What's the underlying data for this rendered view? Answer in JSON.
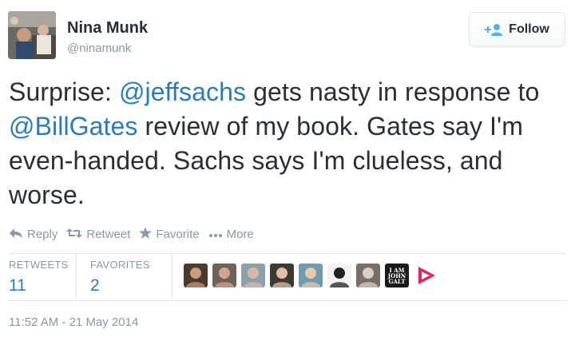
{
  "author": {
    "name": "Nina Munk",
    "handle": "@ninamunk"
  },
  "follow_button": {
    "label": "Follow",
    "icon": "add-user-icon"
  },
  "tweet": {
    "segments": [
      {
        "text": "Surprise: ",
        "mention": false
      },
      {
        "text": "@jeffsachs",
        "mention": true
      },
      {
        "text": " gets nasty in response to ",
        "mention": false
      },
      {
        "text": "@BillGates",
        "mention": true
      },
      {
        "text": " review of my book. Gates say I'm even-handed. Sachs says I'm clueless, and worse.",
        "mention": false
      }
    ]
  },
  "actions": {
    "reply": {
      "label": "Reply",
      "icon": "reply-icon"
    },
    "retweet": {
      "label": "Retweet",
      "icon": "retweet-icon"
    },
    "favorite": {
      "label": "Favorite",
      "icon": "star-icon"
    },
    "more": {
      "label": "More",
      "icon": "ellipsis-icon"
    }
  },
  "stats": {
    "retweets_label": "RETWEETS",
    "retweets_count": "11",
    "favorites_label": "FAVORITES",
    "favorites_count": "2"
  },
  "favorited_by": {
    "avatars": [
      {
        "name": "avatar-1",
        "bg": "#4a3b2e",
        "fg": "#c79b7e"
      },
      {
        "name": "avatar-2",
        "bg": "#6c6258",
        "fg": "#d3a48c"
      },
      {
        "name": "avatar-3",
        "bg": "#8aa0ad",
        "fg": "#d6b8a3"
      },
      {
        "name": "avatar-4",
        "bg": "#3b3a33",
        "fg": "#e0bfa6"
      },
      {
        "name": "avatar-5",
        "bg": "#6e9bb0",
        "fg": "#e8c8a8"
      },
      {
        "name": "avatar-6",
        "bg": "#f2f2f2",
        "fg": "#222222"
      },
      {
        "name": "avatar-7",
        "bg": "#7a6f68",
        "fg": "#d9cfc6"
      },
      {
        "name": "avatar-8",
        "bg": "#1a1a1a",
        "fg": "#ffffff",
        "text_lines": [
          "I AM",
          "JOHN",
          "GALT"
        ]
      }
    ],
    "more_icon": "play-arrow-icon"
  },
  "timestamp": "11:52 AM - 21 May 2014",
  "colors": {
    "link": "#2b7bb9",
    "muted": "#8899a6",
    "text": "#292f33",
    "border": "#e1e8ed"
  }
}
